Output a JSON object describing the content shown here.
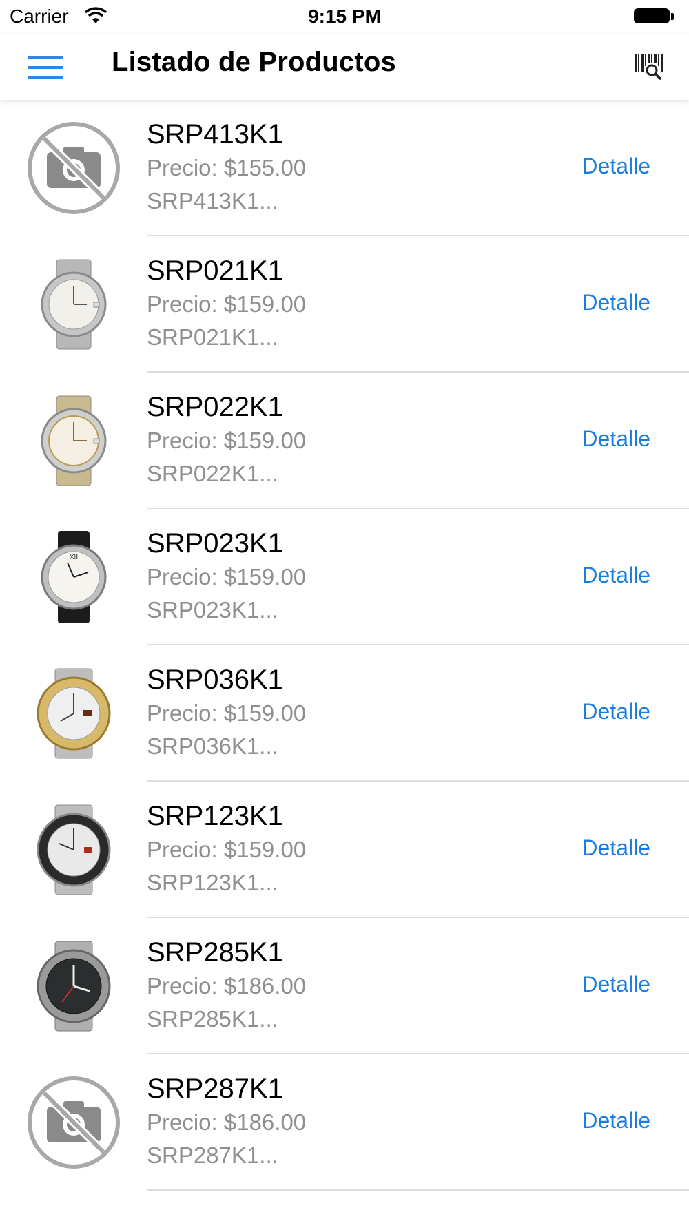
{
  "status_bar": {
    "carrier": "Carrier",
    "time": "9:15 PM"
  },
  "nav": {
    "title": "Listado de Productos",
    "menu_icon": "hamburger-menu-icon",
    "right_icon": "barcode-scan-icon"
  },
  "colors": {
    "accent": "#1b7cdf",
    "secondary_text": "#8e8e93",
    "separator": "#dcdcdc"
  },
  "products": [
    {
      "name": "SRP413K1",
      "price": "Precio: $155.00",
      "desc": "SRP413K1...",
      "image": "no-photo-icon",
      "action": "Detalle"
    },
    {
      "name": "SRP021K1",
      "price": "Precio: $159.00",
      "desc": "SRP021K1...",
      "image": "watch-silver-white-dial",
      "action": "Detalle"
    },
    {
      "name": "SRP022K1",
      "price": "Precio: $159.00",
      "desc": "SRP022K1...",
      "image": "watch-two-tone-white-dial",
      "action": "Detalle"
    },
    {
      "name": "SRP023K1",
      "price": "Precio: $159.00",
      "desc": "SRP023K1...",
      "image": "watch-black-leather-strap",
      "action": "Detalle"
    },
    {
      "name": "SRP036K1",
      "price": "Precio: $159.00",
      "desc": "SRP036K1...",
      "image": "watch-gold-bezel",
      "action": "Detalle"
    },
    {
      "name": "SRP123K1",
      "price": "Precio: $159.00",
      "desc": "SRP123K1...",
      "image": "watch-silver-black-bezel",
      "action": "Detalle"
    },
    {
      "name": "SRP285K1",
      "price": "Precio: $186.00",
      "desc": "SRP285K1...",
      "image": "watch-black-dial",
      "action": "Detalle"
    },
    {
      "name": "SRP287K1",
      "price": "Precio: $186.00",
      "desc": "SRP287K1...",
      "image": "no-photo-icon",
      "action": "Detalle"
    }
  ]
}
